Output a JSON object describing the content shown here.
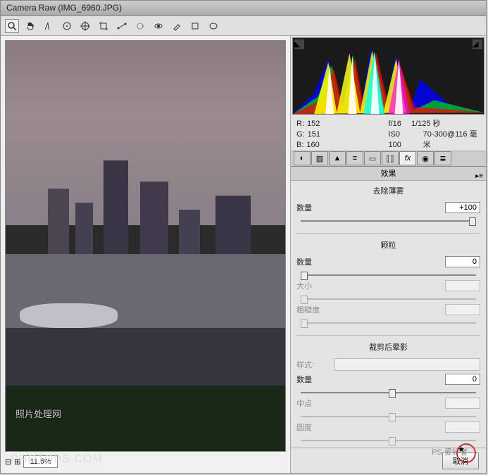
{
  "title": "Camera Raw (IMG_6960.JPG)",
  "toolbar": {
    "zoom": "11.6%"
  },
  "info": {
    "r_label": "R:",
    "r": "152",
    "g_label": "G:",
    "g": "151",
    "b_label": "B:",
    "b": "160",
    "aperture": "f/16",
    "shutter": "1/125 秒",
    "iso": "IS0 100",
    "lens": "70-300@116 毫米"
  },
  "panel": {
    "header": "效果",
    "dehaze": {
      "title": "去除薄雾",
      "amount_label": "数量",
      "amount": "+100"
    },
    "grain": {
      "title": "颗粒",
      "amount_label": "数量",
      "amount": "0",
      "size_label": "大小",
      "rough_label": "粗糙度"
    },
    "vignette": {
      "title": "裁剪后晕影",
      "style_label": "样式:",
      "amount_label": "数量",
      "amount": "0",
      "mid_label": "中点",
      "round_label": "圆度"
    }
  },
  "footer": {
    "cancel": "取消"
  },
  "watermark": {
    "text1": "照片处理网",
    "text2": "PHOTOPS.COM",
    "text3": "PS 爱好者"
  }
}
